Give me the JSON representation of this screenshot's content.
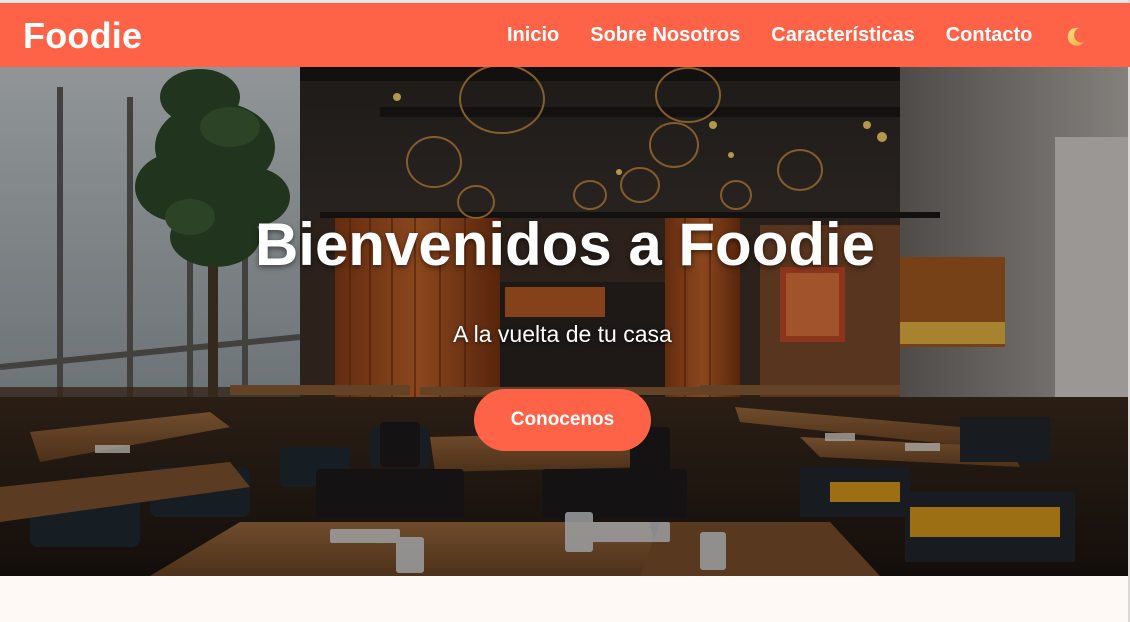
{
  "navbar": {
    "brand": "Foodie",
    "links": [
      "Inicio",
      "Sobre Nosotros",
      "Características",
      "Contacto"
    ],
    "theme_toggle_icon": "moon-icon"
  },
  "hero": {
    "title": "Bienvenidos a Foodie",
    "subtitle": "A la vuelta de tu casa",
    "button_label": "Conocenos",
    "background_image": "restaurant-interior-photo"
  },
  "colors": {
    "accent": "#ff6347",
    "page_background": "#fff9f5",
    "moon": "#f4c95d"
  }
}
